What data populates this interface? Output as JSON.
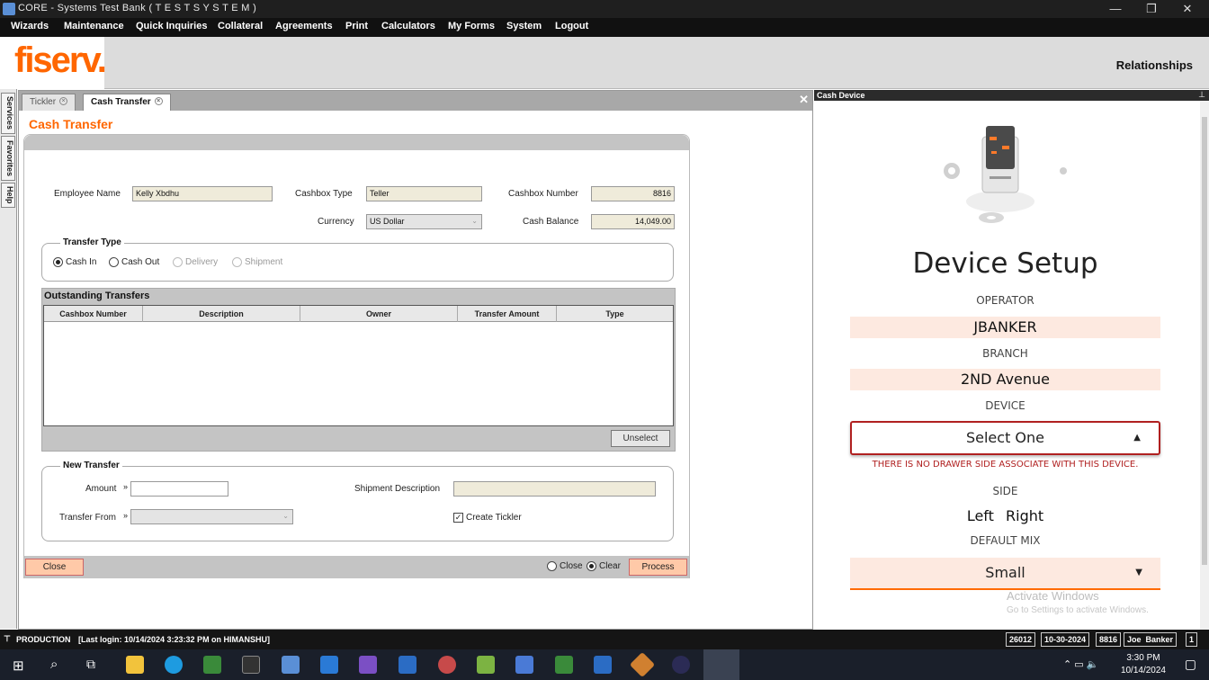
{
  "window": {
    "title": "CORE - Systems Test Bank ( T E S T   S Y S T E M )"
  },
  "menu": [
    "Wizards",
    "Maintenance",
    "Quick Inquiries",
    "Collateral",
    "Agreements",
    "Print",
    "Calculators",
    "My Forms",
    "System",
    "Logout"
  ],
  "header": {
    "logo": "fiserv.",
    "relationships": "Relationships"
  },
  "side_tabs": [
    "Services",
    "Favorites",
    "Help"
  ],
  "tabs": [
    {
      "label": "Tickler"
    },
    {
      "label": "Cash Transfer"
    }
  ],
  "form": {
    "title": "Cash Transfer",
    "employee_name_label": "Employee Name",
    "employee_name": "Kelly Xbdhu",
    "cashbox_type_label": "Cashbox Type",
    "cashbox_type": "Teller",
    "cashbox_number_label": "Cashbox Number",
    "cashbox_number": "8816",
    "currency_label": "Currency",
    "currency": "US Dollar",
    "cash_balance_label": "Cash Balance",
    "cash_balance": "14,049.00",
    "transfer_type": {
      "legend": "Transfer Type",
      "options": [
        "Cash In",
        "Cash Out",
        "Delivery",
        "Shipment"
      ],
      "selected": "Cash In"
    },
    "outstanding": {
      "title": "Outstanding Transfers",
      "columns": [
        "Cashbox Number",
        "Description",
        "Owner",
        "Transfer Amount",
        "Type"
      ],
      "rows": [],
      "unselect_label": "Unselect"
    },
    "new_transfer": {
      "legend": "New Transfer",
      "amount_label": "Amount",
      "amount_marker": "»",
      "amount": "",
      "shipment_description_label": "Shipment Description",
      "shipment_description": "",
      "transfer_from_label": "Transfer From",
      "transfer_from": "",
      "create_tickler_label": "Create Tickler",
      "create_tickler_checked": true
    },
    "close_label": "Close",
    "after_options": [
      "Close",
      "Clear"
    ],
    "after_selected": "Clear",
    "process_label": "Process"
  },
  "device": {
    "panel_title": "Cash Device",
    "heading": "Device Setup",
    "operator_label": "OPERATOR",
    "operator": "JBANKER",
    "branch_label": "BRANCH",
    "branch": "2ND Avenue",
    "device_label": "DEVICE",
    "device_select": "Select One",
    "error": "THERE IS NO DRAWER SIDE ASSOCIATE WITH THIS DEVICE.",
    "side_label": "SIDE",
    "side_left": "Left",
    "side_right": "Right",
    "default_mix_label": "DEFAULT MIX",
    "default_mix": "Small",
    "watermark_title": "Activate Windows",
    "watermark_sub": "Go to Settings to activate Windows."
  },
  "status": {
    "env": "PRODUCTION",
    "last_login": "[Last login: 10/14/2024 3:23:32 PM on HIMANSHU]",
    "boxes": [
      "26012",
      "10-30-2024",
      "8816",
      "Joe  Banker",
      "1"
    ]
  },
  "taskbar": {
    "time": "3:30 PM",
    "date": "10/14/2024"
  },
  "colors": {
    "accent": "#ff6600",
    "error": "#b02020",
    "field_bg": "#efebda"
  }
}
